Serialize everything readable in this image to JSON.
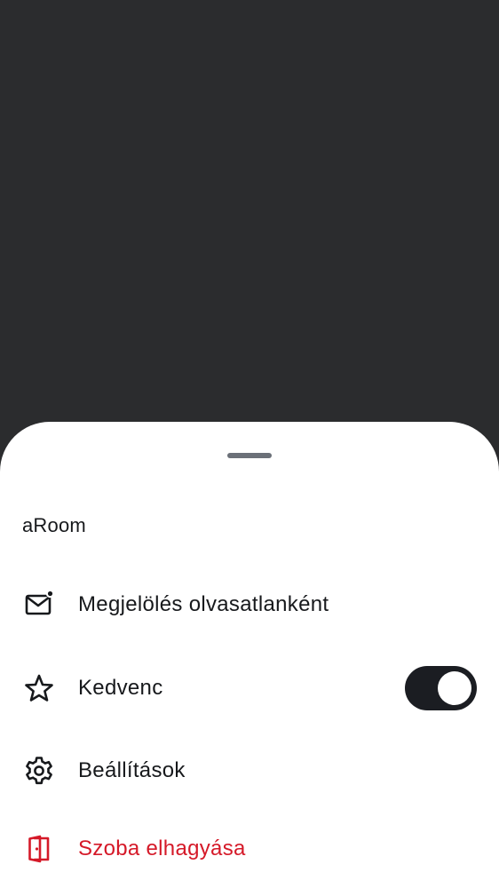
{
  "sheet": {
    "title": "aRoom",
    "items": [
      {
        "label": "Megjelölés olvasatlanként",
        "icon": "mail-unread-icon"
      },
      {
        "label": "Kedvenc",
        "icon": "star-icon",
        "toggle_on": true
      },
      {
        "label": "Beállítások",
        "icon": "gear-icon"
      },
      {
        "label": "Szoba elhagyása",
        "icon": "leave-room-icon",
        "color": "#d51928"
      }
    ]
  },
  "colors": {
    "scrim": "#2b2c2e",
    "text": "#17191c",
    "danger": "#d51928",
    "toggle_track": "#1b1d22"
  }
}
